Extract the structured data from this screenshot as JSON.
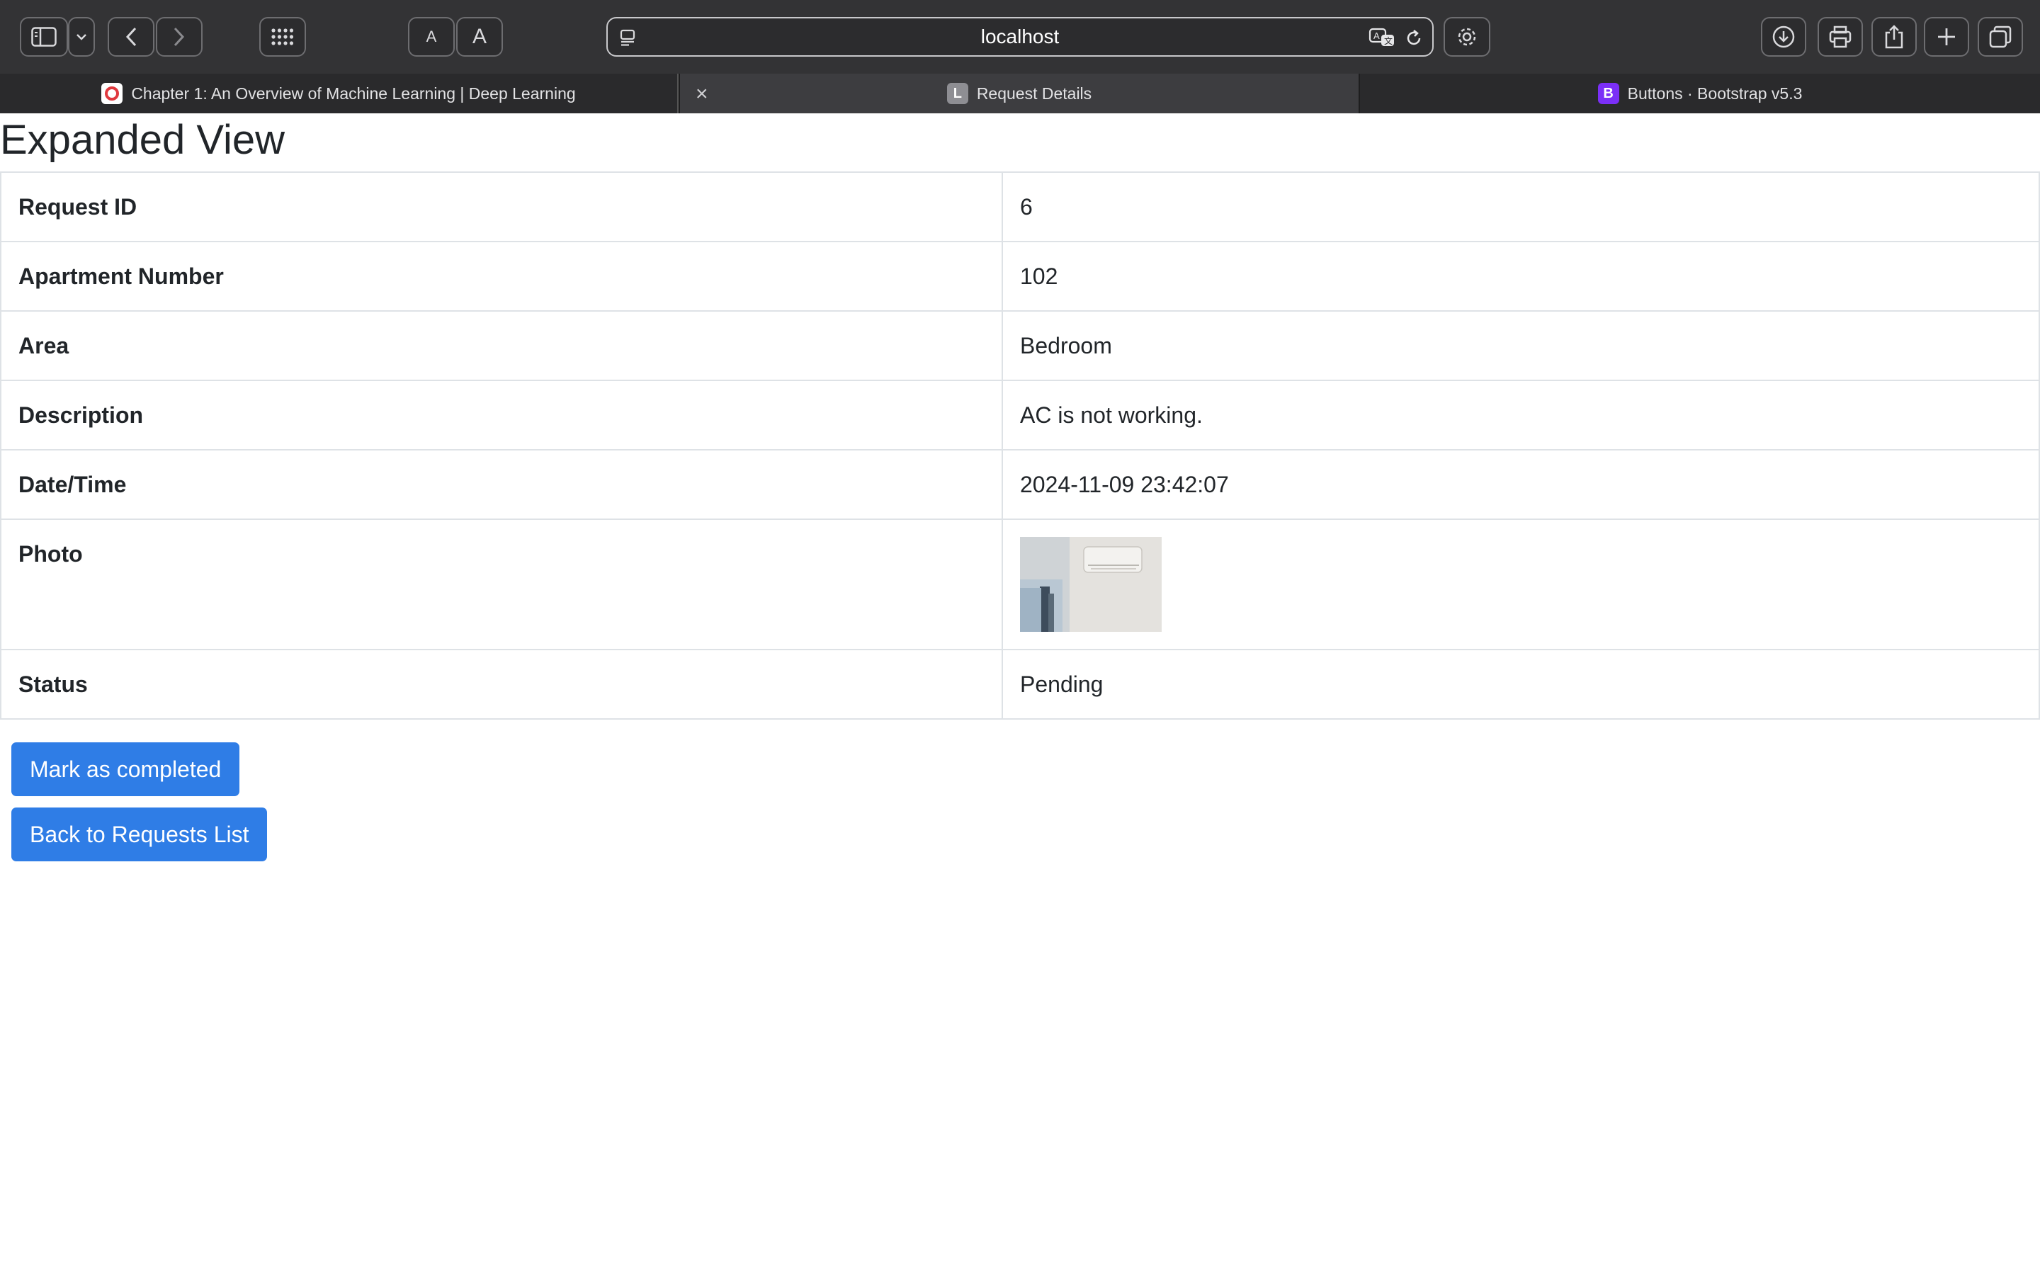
{
  "browser": {
    "url": "localhost",
    "tabs": [
      {
        "label": "Chapter 1: An Overview of Machine Learning | Deep Learning",
        "favicon_letter": "O",
        "favicon_color": "#e0393e"
      },
      {
        "label": "Request Details",
        "favicon_letter": "L",
        "favicon_color": "#8e8e93"
      },
      {
        "label": "Buttons · Bootstrap v5.3",
        "favicon_letter": "B",
        "favicon_color": "#7b2ff7"
      }
    ],
    "text_size_small": "A",
    "text_size_large": "A",
    "tab_close_glyph": "×"
  },
  "page": {
    "title": "Expanded View",
    "fields": [
      {
        "label": "Request ID",
        "value": "6"
      },
      {
        "label": "Apartment Number",
        "value": "102"
      },
      {
        "label": "Area",
        "value": "Bedroom"
      },
      {
        "label": "Description",
        "value": "AC is not working."
      },
      {
        "label": "Date/Time",
        "value": "2024-11-09 23:42:07"
      },
      {
        "label": "Photo",
        "value": ""
      },
      {
        "label": "Status",
        "value": "Pending"
      }
    ],
    "buttons": {
      "mark_completed": "Mark as completed",
      "back": "Back to Requests List"
    }
  },
  "colors": {
    "primary_button": "#2f7de6",
    "toolbar": "#333335"
  }
}
